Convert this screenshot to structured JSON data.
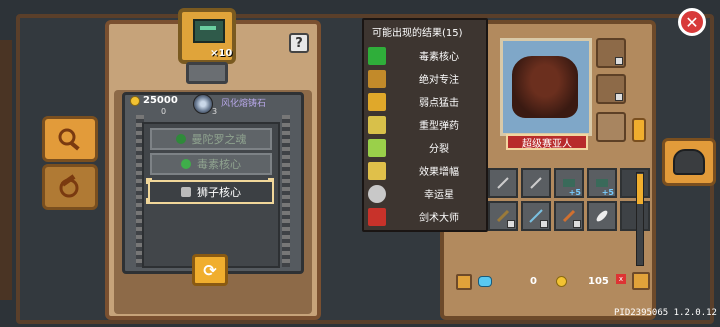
{
  "rune": {
    "count": "×10"
  },
  "help": {
    "label": "?"
  },
  "resources": {
    "coins": "25000",
    "coins_sub": "0",
    "stone_count": "3",
    "stone_name": "风化熔铸石"
  },
  "options": [
    {
      "label": "曼陀罗之魂"
    },
    {
      "label": "毒素核心"
    },
    {
      "label": "狮子核心"
    }
  ],
  "refresh": {
    "label": "⟳"
  },
  "hero": {
    "name": "超级赛亚人"
  },
  "popup": {
    "title": "可能出现的结果(15)",
    "items": [
      {
        "label": "毒素核心",
        "color": "#2fae3a"
      },
      {
        "label": "绝对专注",
        "color": "#c28a2a"
      },
      {
        "label": "弱点猛击",
        "color": "#e0a82a"
      },
      {
        "label": "重型弹药",
        "color": "#d8c04a"
      },
      {
        "label": "分裂",
        "color": "#9ad04a"
      },
      {
        "label": "效果增幅",
        "color": "#e0c04a"
      },
      {
        "label": "幸运星",
        "color": "#c8c8c8"
      },
      {
        "label": "剑术大师",
        "color": "#c8322a"
      }
    ]
  },
  "inventory": {
    "gem_val": "0",
    "coin_val": "105",
    "x_label": "x",
    "plus_labels": [
      "+5",
      "+5"
    ]
  },
  "close": {
    "label": "✕"
  },
  "version": "PID2395065 1.2.0.12"
}
